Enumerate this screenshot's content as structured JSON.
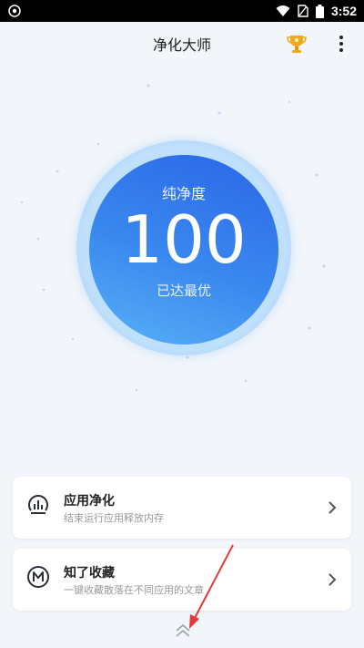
{
  "status_bar": {
    "time": "3:52",
    "icons": [
      "settings-circle-icon",
      "wifi-icon",
      "no-sim-icon",
      "battery-icon"
    ]
  },
  "app_bar": {
    "title": "净化大师",
    "trophy_icon": "trophy-icon",
    "more_icon": "more-vertical-icon"
  },
  "gauge": {
    "title": "纯净度",
    "value": "100",
    "status": "已达最优",
    "colors": {
      "inner_top": "#2b66e7",
      "inner_bottom": "#59b1f7",
      "ring": "#bfe0fb"
    }
  },
  "cards": [
    {
      "title": "应用净化",
      "subtitle": "结束运行应用释放内存",
      "icon": "app-clean-icon",
      "chevron": "chevron-right-icon"
    },
    {
      "title": "知了收藏",
      "subtitle": "一键收藏散落在不同应用的文章",
      "icon": "m-circle-icon",
      "chevron": "chevron-right-icon"
    }
  ],
  "footer": {
    "icon": "double-chevron-up-icon"
  },
  "annotation": {
    "color": "#e53935",
    "icon": "red-arrow"
  }
}
